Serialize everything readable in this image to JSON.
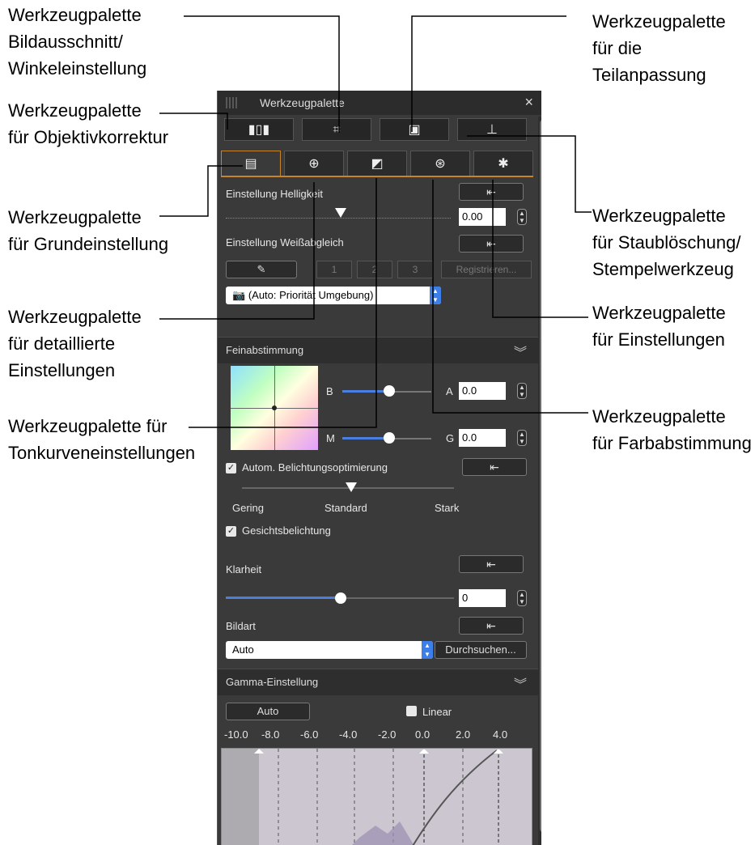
{
  "callouts": {
    "crop": "Werkzeugpalette\nBildausschnitt/\nWinkeleinstellung",
    "lens": "Werkzeugpalette\nfür Objektivkorrektur",
    "basic": "Werkzeugpalette\nfür Grundeinstellung",
    "detail": "Werkzeugpalette\nfür detaillierte\nEinstellungen",
    "tone": "Werkzeugpalette für\nTonkurveneinstellungen",
    "partial": "Werkzeugpalette\nfür die\nTeilanpassung",
    "dust": "Werkzeugpalette\nfür Staublöschung/\nStempelwerkzeug",
    "settings": "Werkzeugpalette\nfür Einstellungen",
    "color": "Werkzeugpalette\nfür Farbabstimmung"
  },
  "panel": {
    "title": "Werkzeugpalette",
    "close": "×",
    "toolbar": [
      "▮▯▮",
      "⌗",
      "▣",
      "⊥"
    ],
    "tabs": [
      "▤",
      "⊕",
      "◩",
      "⊛",
      "✱"
    ],
    "brightness": {
      "label": "Einstellung Helligkeit",
      "value": "0.00",
      "reset": "⇤"
    },
    "wb": {
      "label": "Einstellung Weißabgleich",
      "reset": "⇤",
      "picker": "✎",
      "slots": [
        "1",
        "2",
        "3"
      ],
      "register": "Registrieren...",
      "preset": "(Auto: Priorität Umgebung)"
    },
    "fine": {
      "title": "Feinabstimmung",
      "b_label": "B",
      "a_label": "A",
      "a_value": "0.0",
      "m_label": "M",
      "g_label": "G",
      "g_value": "0.0"
    },
    "alo": {
      "label": "Autom. Belichtungsoptimierung",
      "checked": "✓",
      "reset": "⇤",
      "levels": [
        "Gering",
        "Standard",
        "Stark"
      ],
      "face_label": "Gesichtsbelichtung"
    },
    "clarity": {
      "label": "Klarheit",
      "value": "0",
      "reset": "⇤"
    },
    "picstyle": {
      "label": "Bildart",
      "value": "Auto",
      "reset": "⇤",
      "browse": "Durchsuchen..."
    },
    "gamma": {
      "title": "Gamma-Einstellung",
      "auto": "Auto",
      "linear": "Linear",
      "ticks": [
        "-10.0",
        "-8.0",
        "-6.0",
        "-4.0",
        "-2.0",
        "0.0",
        "2.0",
        "4.0"
      ]
    },
    "chevron": "»"
  }
}
